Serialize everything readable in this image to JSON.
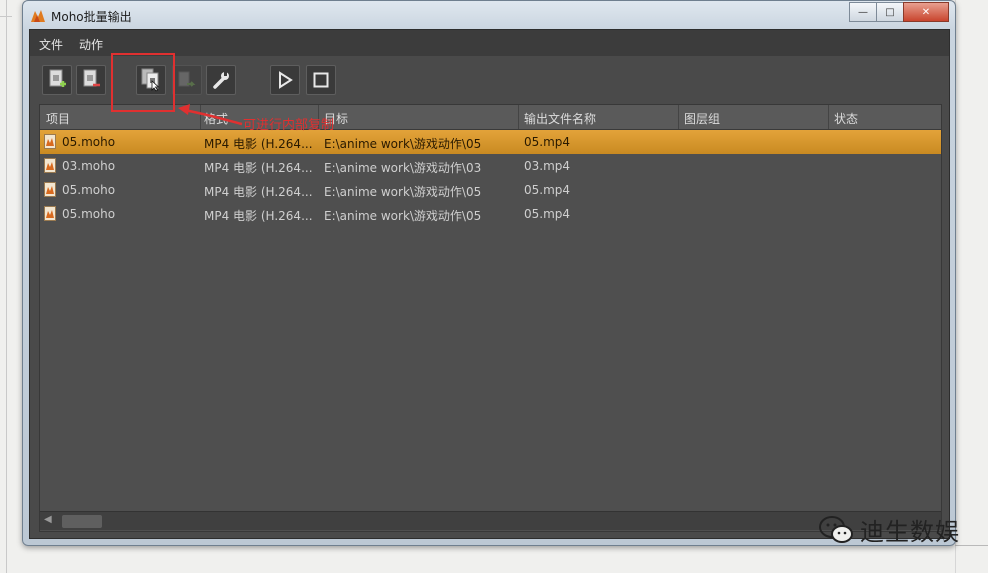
{
  "window": {
    "title": "Moho批量输出",
    "caption_min": "—",
    "caption_max": "□",
    "caption_close": "✕"
  },
  "menu": {
    "items": [
      "文件",
      "动作"
    ]
  },
  "toolbar": {
    "buttons": [
      "add-file-icon",
      "remove-file-icon",
      "duplicate-icon",
      "convert-icon",
      "wrench-icon",
      "play-icon",
      "stop-icon"
    ]
  },
  "table": {
    "headers": [
      "项目",
      "格式",
      "目标",
      "输出文件名称",
      "图层组",
      "状态"
    ],
    "rows": [
      {
        "project": "05.moho",
        "format": "MP4 电影 (H.264...",
        "target": "E:\\anime work\\游戏动作\\05",
        "output": "05.mp4",
        "layer_group": "",
        "status": "",
        "selected": true
      },
      {
        "project": "03.moho",
        "format": "MP4 电影 (H.264...",
        "target": "E:\\anime work\\游戏动作\\03",
        "output": "03.mp4",
        "layer_group": "",
        "status": "",
        "selected": false
      },
      {
        "project": "05.moho",
        "format": "MP4 电影 (H.264...",
        "target": "E:\\anime work\\游戏动作\\05",
        "output": "05.mp4",
        "layer_group": "",
        "status": "",
        "selected": false
      },
      {
        "project": "05.moho",
        "format": "MP4 电影 (H.264...",
        "target": "E:\\anime work\\游戏动作\\05",
        "output": "05.mp4",
        "layer_group": "",
        "status": "",
        "selected": false
      }
    ]
  },
  "annotation": {
    "text": "可进行内部复制",
    "color": "#e03030"
  },
  "watermark": {
    "text": "迪生数娱"
  },
  "colors": {
    "selected_row": "#d99a30",
    "panel_bg": "#4a4a4a",
    "accent_red": "#e03030"
  }
}
